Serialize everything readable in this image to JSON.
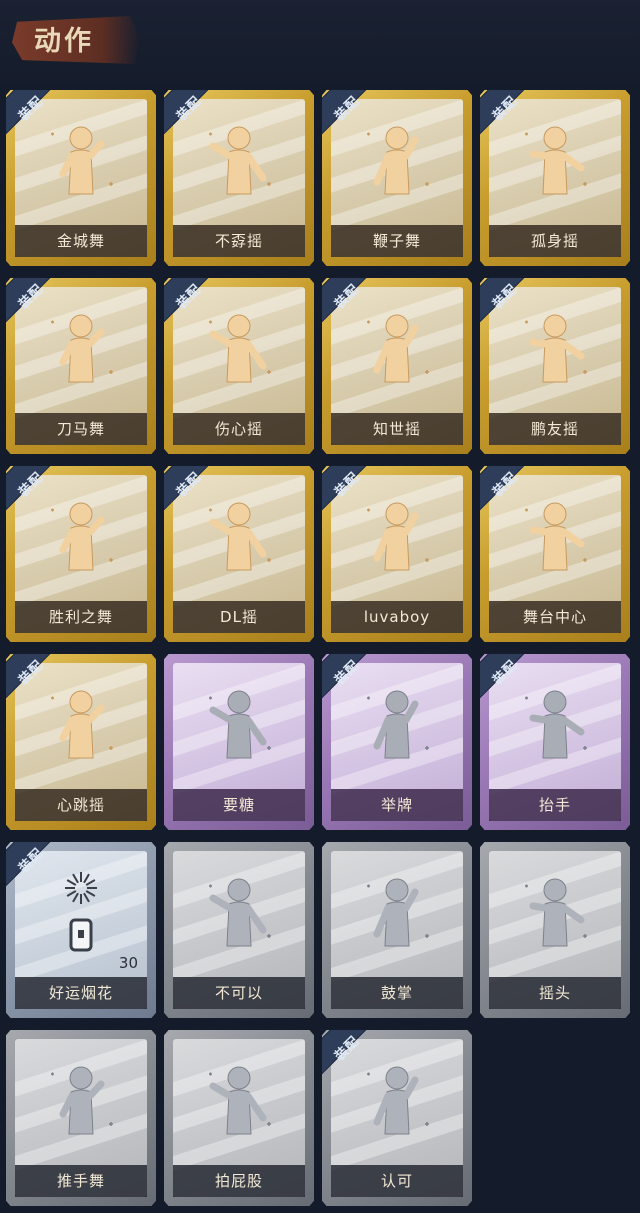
{
  "header": {
    "title": "动作"
  },
  "badge_label": "装配",
  "cards": [
    {
      "label": "金城舞",
      "tier": "gold",
      "equipped": true,
      "icon": "dancer-wave-icon"
    },
    {
      "label": "不孬摇",
      "tier": "gold",
      "equipped": true,
      "icon": "dancer-arm-up-icon"
    },
    {
      "label": "鞭子舞",
      "tier": "gold",
      "equipped": true,
      "icon": "dancer-heart-icon"
    },
    {
      "label": "孤身摇",
      "tier": "gold",
      "equipped": true,
      "icon": "dancer-stars-icon"
    },
    {
      "label": "刀马舞",
      "tier": "gold",
      "equipped": true,
      "icon": "dancer-cross-arm-icon"
    },
    {
      "label": "伤心摇",
      "tier": "gold",
      "equipped": true,
      "icon": "dancer-heart-hands-icon"
    },
    {
      "label": "知世摇",
      "tier": "gold",
      "equipped": true,
      "icon": "dancer-music-icon"
    },
    {
      "label": "鹏友摇",
      "tier": "gold",
      "equipped": true,
      "icon": "dancer-point-icon"
    },
    {
      "label": "胜利之舞",
      "tier": "gold",
      "equipped": true,
      "icon": "dancer-victory-icon"
    },
    {
      "label": "DL摇",
      "tier": "gold",
      "equipped": true,
      "icon": "dancer-reach-icon"
    },
    {
      "label": "luvaboy",
      "tier": "gold",
      "equipped": true,
      "icon": "dancer-hug-icon"
    },
    {
      "label": "舞台中心",
      "tier": "gold",
      "equipped": true,
      "icon": "dancer-center-icon"
    },
    {
      "label": "心跳摇",
      "tier": "gold",
      "equipped": true,
      "icon": "dancer-heartbeat-icon"
    },
    {
      "label": "要糖",
      "tier": "purple",
      "equipped": false,
      "icon": "figure-ask-icon"
    },
    {
      "label": "举牌",
      "tier": "purple",
      "equipped": true,
      "icon": "figure-sign-icon"
    },
    {
      "label": "抬手",
      "tier": "purple",
      "equipped": true,
      "icon": "figure-raise-hand-icon"
    },
    {
      "label": "好运烟花",
      "tier": "blue",
      "equipped": true,
      "icon": "firework-can-icon",
      "count": "30"
    },
    {
      "label": "不可以",
      "tier": "gray",
      "equipped": false,
      "icon": "finger-no-icon"
    },
    {
      "label": "鼓掌",
      "tier": "gray",
      "equipped": false,
      "icon": "clap-hands-icon"
    },
    {
      "label": "摇头",
      "tier": "gray",
      "equipped": false,
      "icon": "figure-shake-head-icon"
    },
    {
      "label": "推手舞",
      "tier": "gray",
      "equipped": false,
      "icon": "figure-push-hand-icon"
    },
    {
      "label": "拍屁股",
      "tier": "gray",
      "equipped": false,
      "icon": "figure-pat-icon"
    },
    {
      "label": "认可",
      "tier": "gray",
      "equipped": true,
      "icon": "thumbs-up-icon"
    }
  ]
}
